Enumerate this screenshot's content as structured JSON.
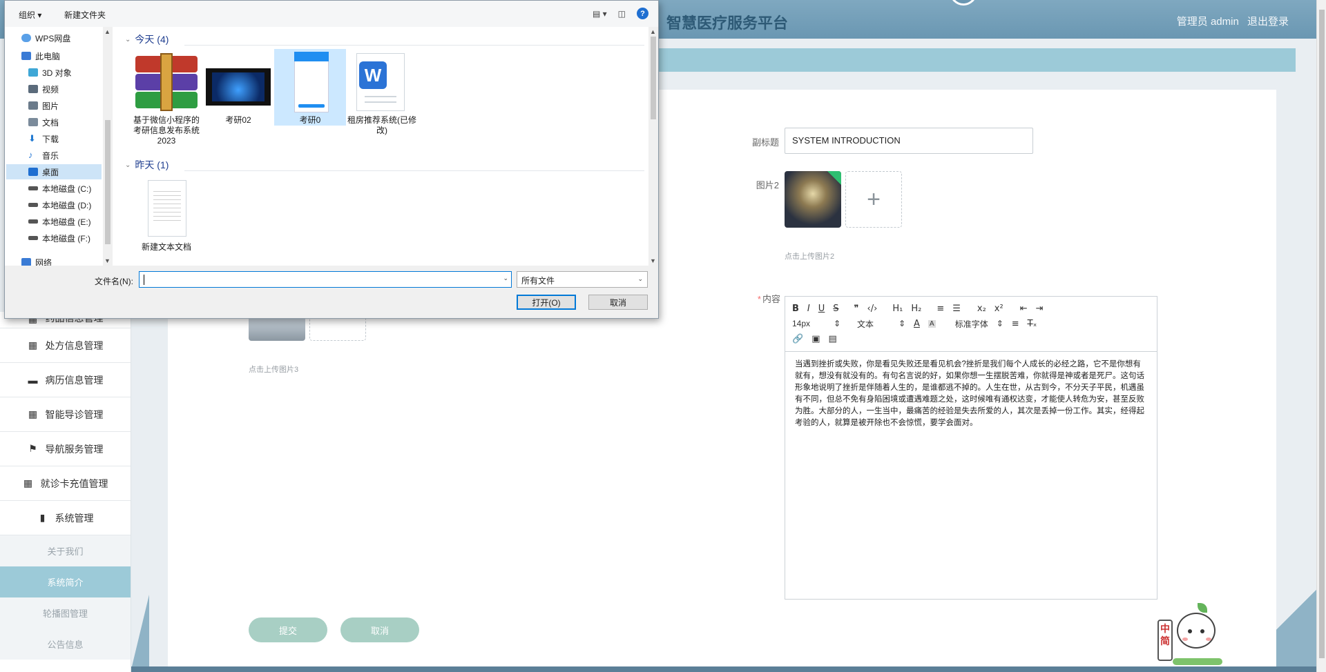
{
  "app": {
    "title": "智慧医疗服务平台",
    "user_label": "管理员 admin",
    "logout": "退出登录"
  },
  "sidebar": {
    "items": [
      {
        "label": "药品信息管理",
        "icon": "grid-icon"
      },
      {
        "label": "处方信息管理",
        "icon": "grid-icon"
      },
      {
        "label": "病历信息管理",
        "icon": "ticket-icon"
      },
      {
        "label": "智能导诊管理",
        "icon": "grid-icon"
      },
      {
        "label": "导航服务管理",
        "icon": "flag-icon"
      },
      {
        "label": "就诊卡充值管理",
        "icon": "grid-icon"
      },
      {
        "label": "系统管理",
        "icon": "bar-chart-icon"
      }
    ],
    "subitems": [
      {
        "label": "关于我们",
        "active": false
      },
      {
        "label": "系统简介",
        "active": true
      },
      {
        "label": "轮播图管理",
        "active": false
      },
      {
        "label": "公告信息",
        "active": false
      }
    ]
  },
  "form": {
    "subtitle_label": "副标题",
    "subtitle_value": "SYSTEM INTRODUCTION",
    "image2_label": "图片2",
    "image2_hint": "点击上传图片2",
    "image3_hint": "点击上传图片3",
    "content_label": "内容",
    "submit": "提交",
    "cancel": "取消"
  },
  "editor": {
    "toolbar_row1": [
      "B",
      "I",
      "U",
      "S",
      "❞",
      "‹/›",
      "H₁",
      "H₂",
      "≡",
      "☰",
      "x₂",
      "x²",
      "⇤",
      "⇥"
    ],
    "font_size": "14px",
    "block_type": "文本",
    "font_family": "标准字体",
    "text": "当遇到挫折或失败，你是看见失败还是看见机会?挫折是我们每个人成长的必经之路，它不是你想有就有，想没有就没有的。有句名言说的好，如果你想一生摆脱苦难，你就得是神或者是死尸。这句话形象地说明了挫折是伴随着人生的，是谁都逃不掉的。人生在世，从古到今，不分天子平民，机遇虽有不同，但总不免有身陷困境或遭遇难题之处，这时候唯有通权达变，才能使人转危为安，甚至反败为胜。大部分的人，一生当中，最痛苦的经验是失去所爱的人，其次是丢掉一份工作。其实，经得起考验的人，就算是被开除也不会惊慌，要学会面对。"
  },
  "mascot": {
    "sign_text": "中简"
  },
  "dialog": {
    "toolbar": {
      "organize": "组织 ▾",
      "new_folder": "新建文件夹"
    },
    "nav": [
      {
        "label": "WPS网盘",
        "icon": "cloud-icon",
        "color": "#5aa0e8",
        "selected": false
      },
      {
        "label": "此电脑",
        "icon": "computer-icon",
        "color": "#3a7bd5",
        "selected": false
      },
      {
        "label": "3D 对象",
        "icon": "cube-icon",
        "color": "#3fa7d6",
        "selected": false
      },
      {
        "label": "视频",
        "icon": "video-icon",
        "color": "#5b6b7b",
        "selected": false
      },
      {
        "label": "图片",
        "icon": "picture-icon",
        "color": "#6b7b8b",
        "selected": false
      },
      {
        "label": "文档",
        "icon": "document-icon",
        "color": "#7b8b9b",
        "selected": false
      },
      {
        "label": "下载",
        "icon": "download-icon",
        "color": "#1f78d1",
        "selected": false
      },
      {
        "label": "音乐",
        "icon": "music-icon",
        "color": "#2b7bd6",
        "selected": false
      },
      {
        "label": "桌面",
        "icon": "desktop-icon",
        "color": "#1f6fd1",
        "selected": true
      },
      {
        "label": "本地磁盘 (C:)",
        "icon": "drive-icon",
        "color": "#555",
        "selected": false
      },
      {
        "label": "本地磁盘 (D:)",
        "icon": "drive-icon",
        "color": "#555",
        "selected": false
      },
      {
        "label": "本地磁盘 (E:)",
        "icon": "drive-icon",
        "color": "#555",
        "selected": false
      },
      {
        "label": "本地磁盘 (F:)",
        "icon": "drive-icon",
        "color": "#555",
        "selected": false
      },
      {
        "label": "网络",
        "icon": "network-icon",
        "color": "#3a7bd5",
        "selected": false
      }
    ],
    "groups": [
      {
        "header": "今天 (4)"
      },
      {
        "header": "昨天 (1)"
      }
    ],
    "files_today": [
      {
        "label": "基于微信小程序的考研信息发布系统2023",
        "icon": "winrar-archive-icon"
      },
      {
        "label": "考研02",
        "icon": "video-file-icon"
      },
      {
        "label": "考研0",
        "icon": "image-file-icon"
      },
      {
        "label": "租房推荐系统(已修改)",
        "icon": "word-doc-icon"
      }
    ],
    "files_yesterday": [
      {
        "label": "新建文本文档",
        "icon": "text-file-icon"
      }
    ],
    "filename_label": "文件名(N):",
    "filename_value": "",
    "filetype": "所有文件",
    "open_button": "打开(O)",
    "cancel_button": "取消"
  }
}
